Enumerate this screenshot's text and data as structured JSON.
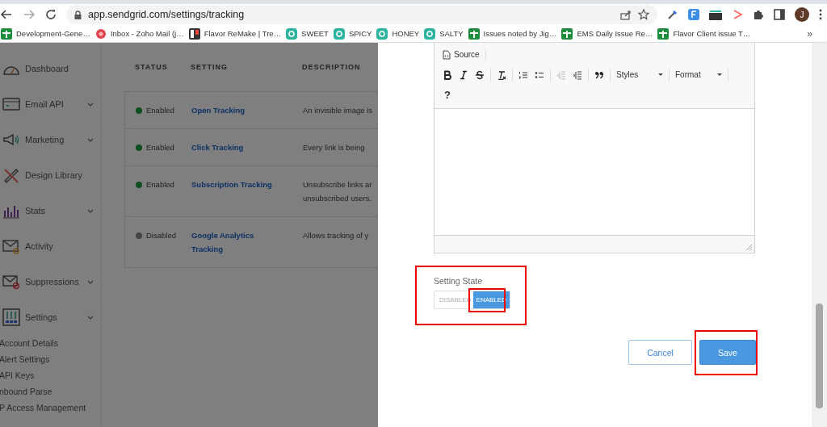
{
  "browser": {
    "url": "app.sendgrid.com/settings/tracking",
    "avatar": "J",
    "overflow": "»",
    "bookmarks": [
      {
        "label": "Development-Gene…",
        "kind": "sheet"
      },
      {
        "label": "Inbox - Zoho Mail (j…",
        "kind": "mail"
      },
      {
        "label": "Flavor ReMake | Tre…",
        "kind": "board"
      },
      {
        "label": "SWEET",
        "kind": "space"
      },
      {
        "label": "SPICY",
        "kind": "space"
      },
      {
        "label": "HONEY",
        "kind": "space"
      },
      {
        "label": "SALTY",
        "kind": "space"
      },
      {
        "label": "Issues noted by Jig…",
        "kind": "sheet"
      },
      {
        "label": "EMS Daily Issue Re…",
        "kind": "sheet"
      },
      {
        "label": "Flavor Client issue T…",
        "kind": "sheet"
      }
    ]
  },
  "sidebar": {
    "items": [
      {
        "label": "Dashboard",
        "kind": "dashboard",
        "expandable": false
      },
      {
        "label": "Email API",
        "kind": "api",
        "expandable": true
      },
      {
        "label": "Marketing",
        "kind": "marketing",
        "expandable": true
      },
      {
        "label": "Design Library",
        "kind": "design",
        "expandable": false
      },
      {
        "label": "Stats",
        "kind": "stats",
        "expandable": true
      },
      {
        "label": "Activity",
        "kind": "activity",
        "expandable": false
      },
      {
        "label": "Suppressions",
        "kind": "suppressions",
        "expandable": true
      },
      {
        "label": "Settings",
        "kind": "settings",
        "expandable": true
      }
    ],
    "sub_items": [
      "Account Details",
      "Alert Settings",
      "API Keys",
      "nbound Parse",
      "P Access Management"
    ]
  },
  "table": {
    "columns": [
      "STATUS",
      "SETTING",
      "DESCRIPTION"
    ],
    "rows": [
      {
        "status": "Enabled",
        "enabled": true,
        "setting": [
          "Open Tracking"
        ],
        "description": [
          "An invisible image is"
        ]
      },
      {
        "status": "Enabled",
        "enabled": true,
        "setting": [
          "Click Tracking"
        ],
        "description": [
          "Every link is being"
        ]
      },
      {
        "status": "Enabled",
        "enabled": true,
        "setting": [
          "Subscription Tracking"
        ],
        "description": [
          "Unsubscribe links ar",
          "unsubscribed users."
        ]
      },
      {
        "status": "Disabled",
        "enabled": false,
        "setting": [
          "Google Analytics",
          "Tracking"
        ],
        "description": [
          "Allows tracking of y"
        ]
      }
    ]
  },
  "modal": {
    "editor": {
      "source": "Source",
      "styles": "Styles",
      "format": "Format",
      "help": "?"
    },
    "setting_state": {
      "label": "Setting State",
      "options": [
        {
          "label": "DISABLED",
          "selected": false
        },
        {
          "label": "ENABLED",
          "selected": true
        }
      ]
    },
    "buttons": [
      {
        "label": "Cancel",
        "kind": "secondary"
      },
      {
        "label": "Save",
        "kind": "primary"
      }
    ]
  }
}
